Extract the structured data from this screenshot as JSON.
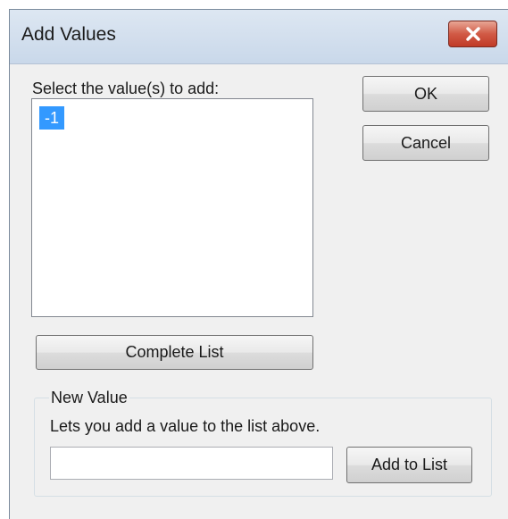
{
  "dialog": {
    "title": "Add Values",
    "close_icon": "close-icon"
  },
  "values_list": {
    "label": "Select the value(s) to add:",
    "items": [
      {
        "label": "-1",
        "selected": true
      }
    ]
  },
  "buttons": {
    "ok": "OK",
    "cancel": "Cancel",
    "complete_list": "Complete List",
    "add_to_list": "Add to List"
  },
  "new_value": {
    "group_label": "New Value",
    "description": "Lets you add a value to the list above.",
    "input_value": ""
  },
  "colors": {
    "selection": "#3399ff",
    "close_button": "#c8452f",
    "window_bg": "#f0f0f0"
  }
}
